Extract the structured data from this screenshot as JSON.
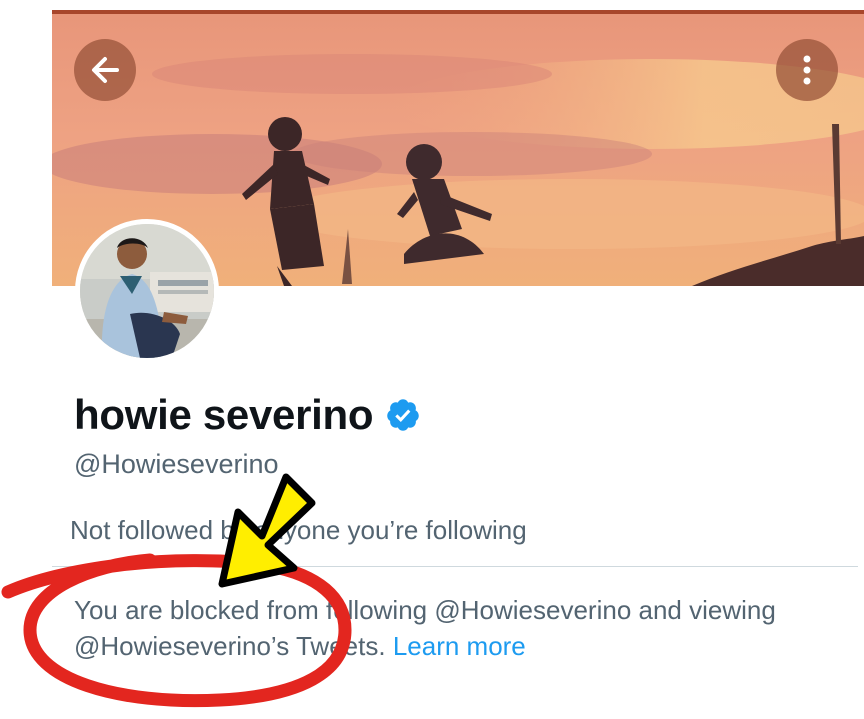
{
  "profile": {
    "display_name": "howie severino",
    "handle": "@Howieseverino",
    "verified": true,
    "followers_note": "Not followed by anyone you’re following",
    "blocked_text": "You are blocked from following @Howieseverino and viewing @Howieseverino’s Tweets.",
    "learn_more": "Learn more"
  },
  "header": {
    "back_icon": "arrow-left-icon",
    "more_icon": "more-vertical-icon"
  },
  "colors": {
    "accent_link": "#1d9bf0",
    "verified_badge": "#1d9bf0",
    "annotation_arrow": "#ffee00",
    "annotation_circle": "#e3261f"
  }
}
